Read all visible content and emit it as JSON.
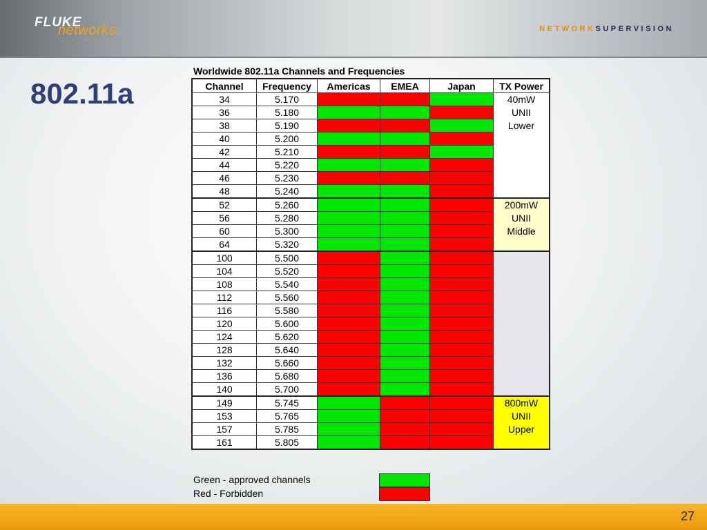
{
  "header": {
    "brand_primary": "FLUKE",
    "brand_secondary": "networks.",
    "brand_dots": ". · · · ·",
    "tagline_part1": "NETWORK",
    "tagline_part2": "SUPER",
    "tagline_part3": "VISION"
  },
  "slide": {
    "title": "802.11a",
    "page_number": "27"
  },
  "table": {
    "caption": "Worldwide 802.11a Channels and Frequencies",
    "headers": [
      "Channel",
      "Frequency",
      "Americas",
      "EMEA",
      "Japan",
      "TX Power"
    ],
    "rows": [
      {
        "channel": "34",
        "frequency": "5.170",
        "americas": "r",
        "emea": "r",
        "japan": "g"
      },
      {
        "channel": "36",
        "frequency": "5.180",
        "americas": "g",
        "emea": "g",
        "japan": "r"
      },
      {
        "channel": "38",
        "frequency": "5.190",
        "americas": "r",
        "emea": "r",
        "japan": "g"
      },
      {
        "channel": "40",
        "frequency": "5.200",
        "americas": "g",
        "emea": "g",
        "japan": "r"
      },
      {
        "channel": "42",
        "frequency": "5.210",
        "americas": "r",
        "emea": "r",
        "japan": "g"
      },
      {
        "channel": "44",
        "frequency": "5.220",
        "americas": "g",
        "emea": "g",
        "japan": "r"
      },
      {
        "channel": "46",
        "frequency": "5.230",
        "americas": "r",
        "emea": "r",
        "japan": "r"
      },
      {
        "channel": "48",
        "frequency": "5.240",
        "americas": "g",
        "emea": "g",
        "japan": "r"
      },
      {
        "channel": "52",
        "frequency": "5.260",
        "americas": "g",
        "emea": "g",
        "japan": "r"
      },
      {
        "channel": "56",
        "frequency": "5.280",
        "americas": "g",
        "emea": "g",
        "japan": "r"
      },
      {
        "channel": "60",
        "frequency": "5.300",
        "americas": "g",
        "emea": "g",
        "japan": "r"
      },
      {
        "channel": "64",
        "frequency": "5.320",
        "americas": "g",
        "emea": "g",
        "japan": "r"
      },
      {
        "channel": "100",
        "frequency": "5.500",
        "americas": "r",
        "emea": "g",
        "japan": "r"
      },
      {
        "channel": "104",
        "frequency": "5.520",
        "americas": "r",
        "emea": "g",
        "japan": "r"
      },
      {
        "channel": "108",
        "frequency": "5.540",
        "americas": "r",
        "emea": "g",
        "japan": "r"
      },
      {
        "channel": "112",
        "frequency": "5.560",
        "americas": "r",
        "emea": "g",
        "japan": "r"
      },
      {
        "channel": "116",
        "frequency": "5.580",
        "americas": "r",
        "emea": "g",
        "japan": "r"
      },
      {
        "channel": "120",
        "frequency": "5.600",
        "americas": "r",
        "emea": "g",
        "japan": "r"
      },
      {
        "channel": "124",
        "frequency": "5.620",
        "americas": "r",
        "emea": "g",
        "japan": "r"
      },
      {
        "channel": "128",
        "frequency": "5.640",
        "americas": "r",
        "emea": "g",
        "japan": "r"
      },
      {
        "channel": "132",
        "frequency": "5.660",
        "americas": "r",
        "emea": "g",
        "japan": "r"
      },
      {
        "channel": "136",
        "frequency": "5.680",
        "americas": "r",
        "emea": "g",
        "japan": "r"
      },
      {
        "channel": "140",
        "frequency": "5.700",
        "americas": "r",
        "emea": "g",
        "japan": "r"
      },
      {
        "channel": "149",
        "frequency": "5.745",
        "americas": "g",
        "emea": "r",
        "japan": "r"
      },
      {
        "channel": "153",
        "frequency": "5.765",
        "americas": "g",
        "emea": "r",
        "japan": "r"
      },
      {
        "channel": "157",
        "frequency": "5.785",
        "americas": "g",
        "emea": "r",
        "japan": "r"
      },
      {
        "channel": "161",
        "frequency": "5.805",
        "americas": "g",
        "emea": "r",
        "japan": "r"
      }
    ],
    "power_bands": [
      {
        "start": 0,
        "span": 8,
        "lines": [
          "40mW",
          "UNII",
          "Lower"
        ],
        "color": "#ffffff"
      },
      {
        "start": 8,
        "span": 4,
        "lines": [
          "200mW",
          "UNII",
          "Middle"
        ],
        "color": "#ffffcc"
      },
      {
        "start": 12,
        "span": 11,
        "lines": [],
        "color": "#e6e6ea"
      },
      {
        "start": 23,
        "span": 4,
        "lines": [
          "800mW",
          "UNII",
          "Upper"
        ],
        "color": "#ffff00"
      }
    ]
  },
  "legend": [
    {
      "label": "Green - approved channels",
      "status": "g"
    },
    {
      "label": "Red - Forbidden",
      "status": "r"
    }
  ],
  "colors": {
    "approved": "#00e600",
    "forbidden": "#ff0000",
    "title": "#2f3f7a",
    "footer": "#f2a516"
  }
}
